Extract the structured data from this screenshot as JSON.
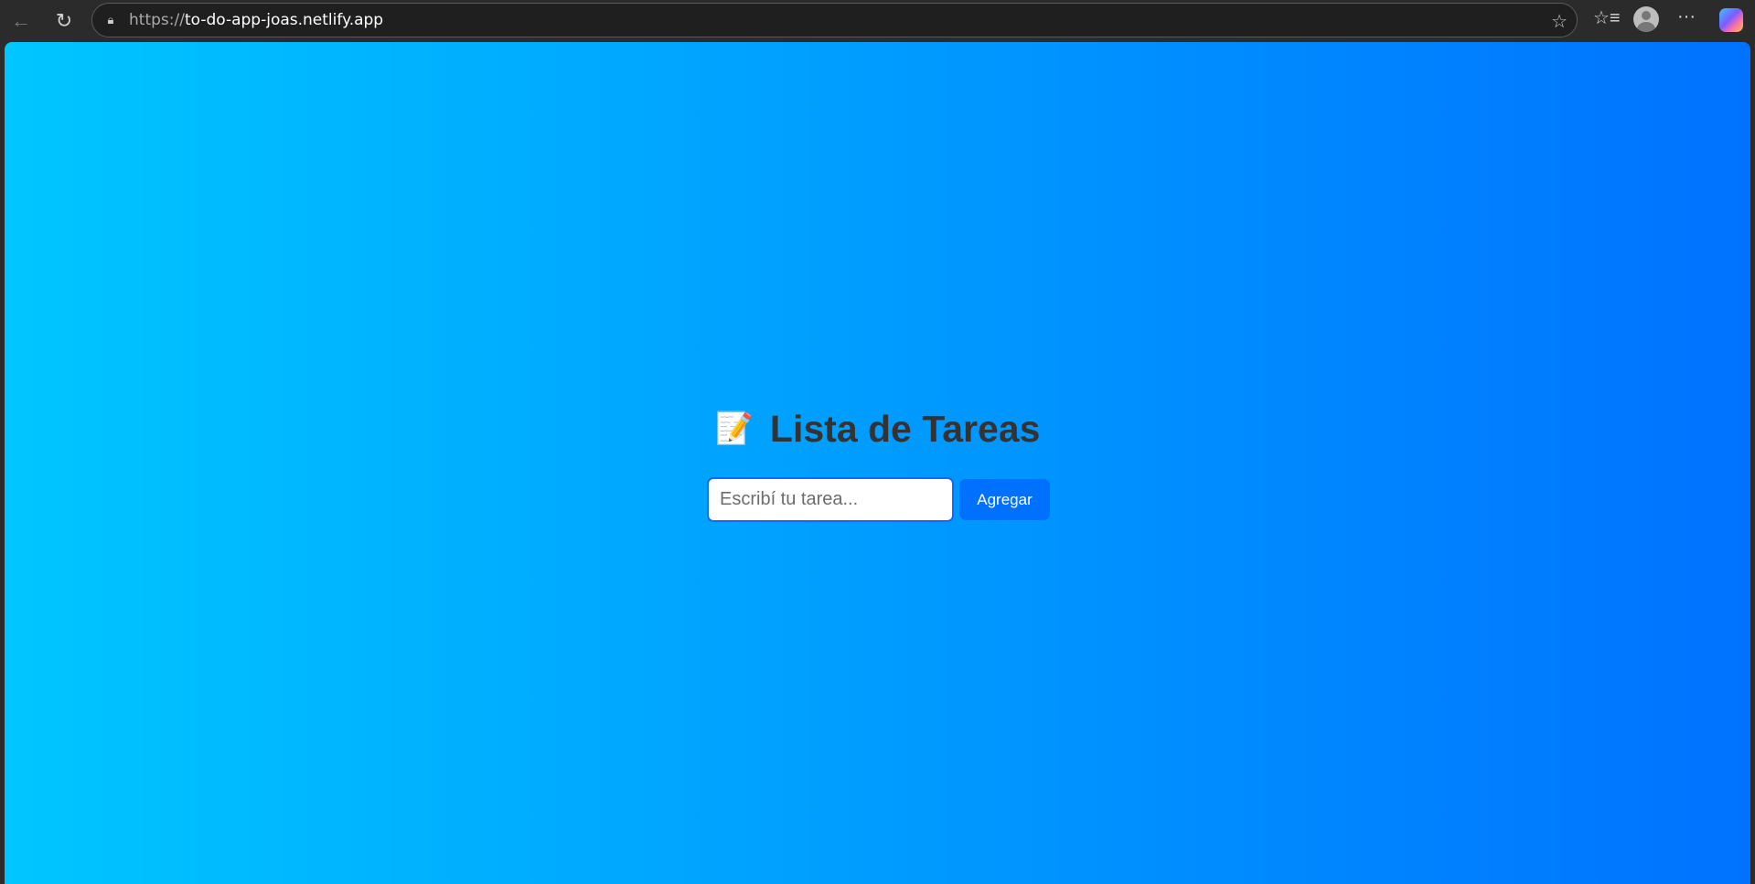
{
  "browser": {
    "url_scheme": "https://",
    "url_host": "to-do-app-joas.netlify.app",
    "icons": [
      "back-icon",
      "reload-icon",
      "lock-icon",
      "star-icon",
      "favorites-icon",
      "profile-avatar",
      "more-icon",
      "copilot-icon"
    ]
  },
  "app": {
    "title": "Lista de Tareas",
    "title_emoji": "📝",
    "input_placeholder": "Escribí tu tarea...",
    "input_value": "",
    "add_button": "Agregar",
    "gradient": [
      "#00c6ff",
      "#0072ff"
    ]
  }
}
